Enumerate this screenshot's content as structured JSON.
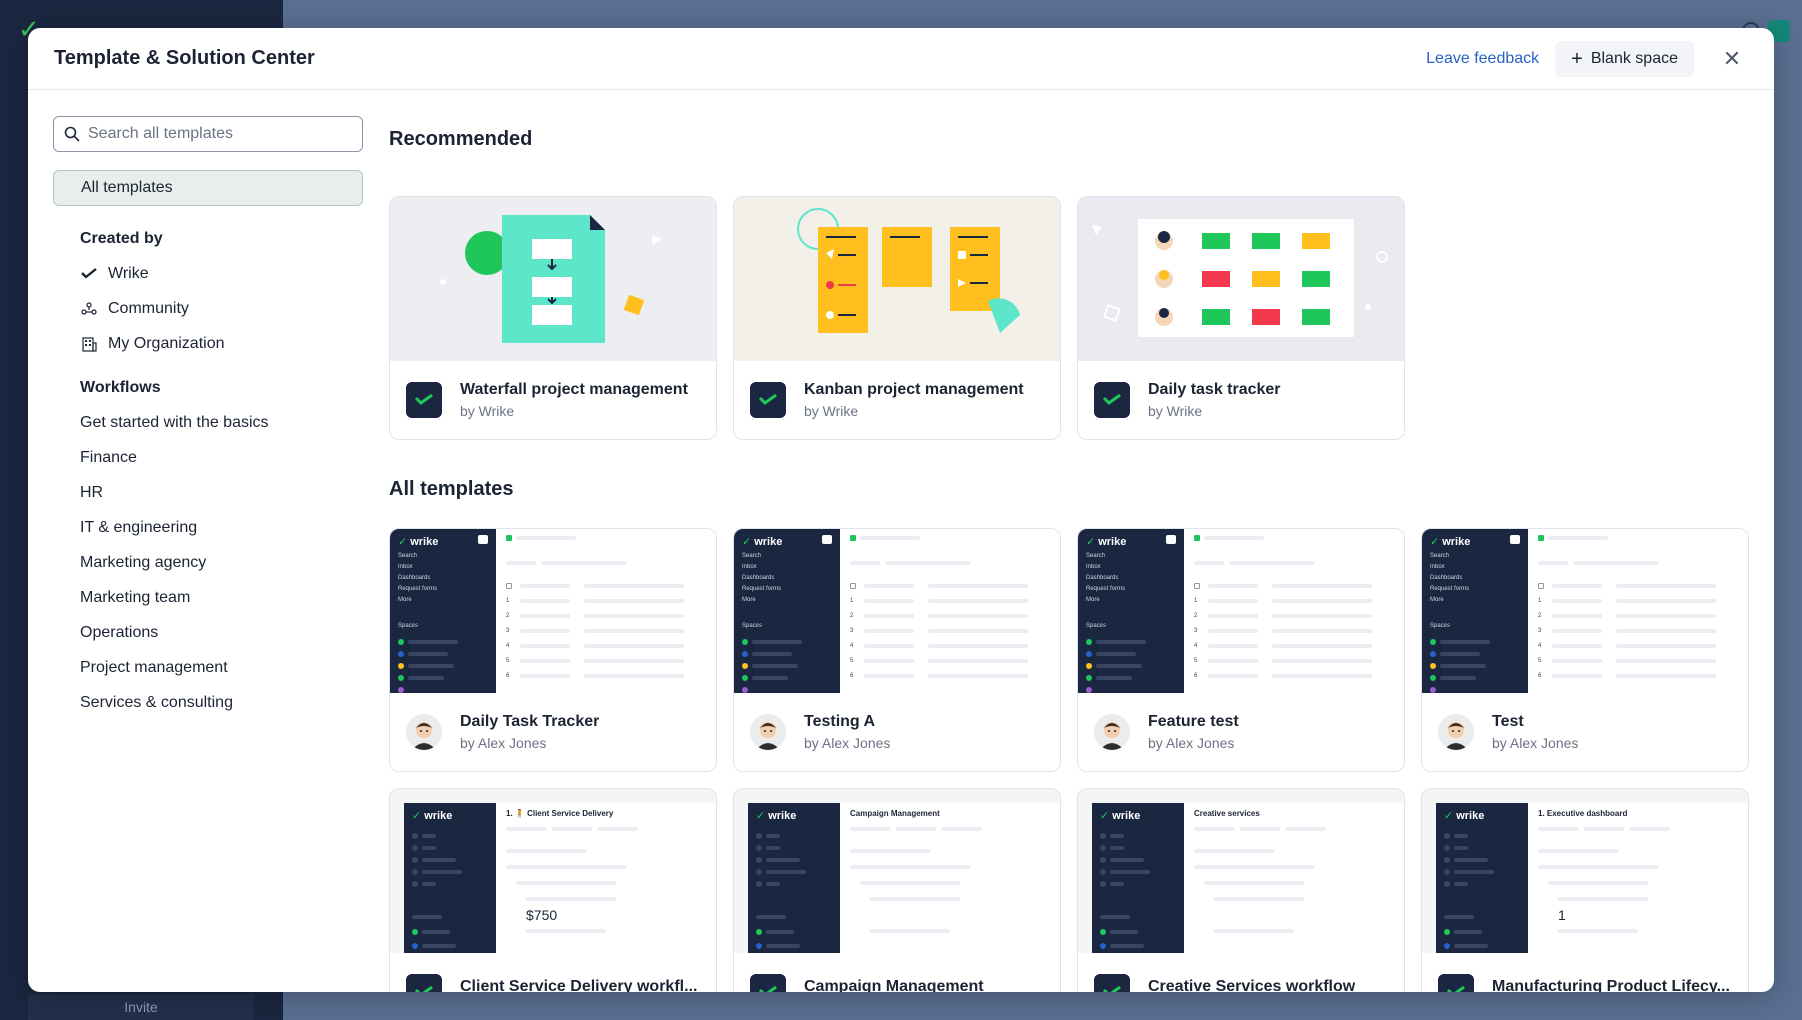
{
  "background": {
    "invite_label": "Invite"
  },
  "modal": {
    "title": "Template & Solution Center",
    "leave_feedback": "Leave feedback",
    "blank_space": "Blank space"
  },
  "search": {
    "placeholder": "Search all templates"
  },
  "sidebar": {
    "all_templates": "All templates",
    "created_by_heading": "Created by",
    "created_by": [
      {
        "label": "Wrike",
        "icon": "wrike-check-icon"
      },
      {
        "label": "Community",
        "icon": "community-icon"
      },
      {
        "label": "My Organization",
        "icon": "building-icon"
      }
    ],
    "workflows_heading": "Workflows",
    "workflows": [
      "Get started with the basics",
      "Finance",
      "HR",
      "IT & engineering",
      "Marketing agency",
      "Marketing team",
      "Operations",
      "Project management",
      "Services & consulting"
    ]
  },
  "recommended": {
    "heading": "Recommended",
    "cards": [
      {
        "title": "Waterfall project management",
        "author": "by Wrike"
      },
      {
        "title": "Kanban project management",
        "author": "by Wrike"
      },
      {
        "title": "Daily task tracker",
        "author": "by Wrike"
      }
    ]
  },
  "all_templates": {
    "heading": "All templates",
    "cards": [
      {
        "title": "Daily Task Tracker",
        "author": "by Alex Jones"
      },
      {
        "title": "Testing A",
        "author": "by Alex Jones"
      },
      {
        "title": "Feature test",
        "author": "by Alex Jones"
      },
      {
        "title": "Test",
        "author": "by Alex Jones"
      }
    ],
    "solution_cards": [
      {
        "title": "Client Service Delivery workfl...",
        "thumb_title": "1. 🧍 Client Service Delivery",
        "thumb_value": "$750"
      },
      {
        "title": "Campaign Management",
        "thumb_title": "Campaign Management"
      },
      {
        "title": "Creative Services workflow",
        "thumb_title": "Creative services"
      },
      {
        "title": "Manufacturing Product Lifecy...",
        "thumb_title": "1. Executive dashboard",
        "thumb_value": "1"
      }
    ]
  },
  "mini": {
    "brand": "wrike",
    "menu": [
      "Search",
      "Inbox",
      "Dashboards",
      "Request forms",
      "More"
    ],
    "spaces": "Spaces",
    "rows": [
      "1",
      "2",
      "3",
      "4",
      "5",
      "6"
    ]
  },
  "colors": {
    "accent_green": "#1fc75a",
    "link_blue": "#2a61c9",
    "dark_navy": "#1b2740",
    "teal": "#5de6c9",
    "yellow": "#ffc01f",
    "red": "#f2384b"
  }
}
